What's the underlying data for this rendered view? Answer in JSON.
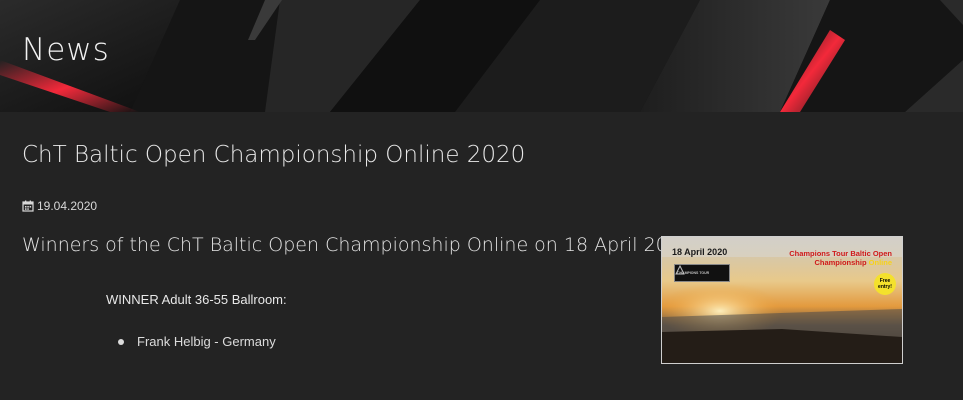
{
  "header": {
    "title": "News"
  },
  "article": {
    "title": "ChT Baltic Open Championship Online 2020",
    "date": "19.04.2020",
    "intro": "Winners of the ChT Baltic Open Championship Online on 18 April 2020:",
    "winner_heading": "WINNER Adult 36-55 Ballroom:",
    "winners": [
      "Frank Helbig - Germany"
    ]
  },
  "poster": {
    "date": "18 April 2020",
    "headline": "Champions Tour Baltic Open Championship",
    "headline_online": "Online",
    "badge": "Free entry!",
    "logo_text": "CHAMPIONS TOUR"
  },
  "icons": {
    "calendar": "calendar-icon"
  },
  "colors": {
    "background": "#232323",
    "hero_accent": "#e0182a",
    "text": "#e6e6e6"
  }
}
